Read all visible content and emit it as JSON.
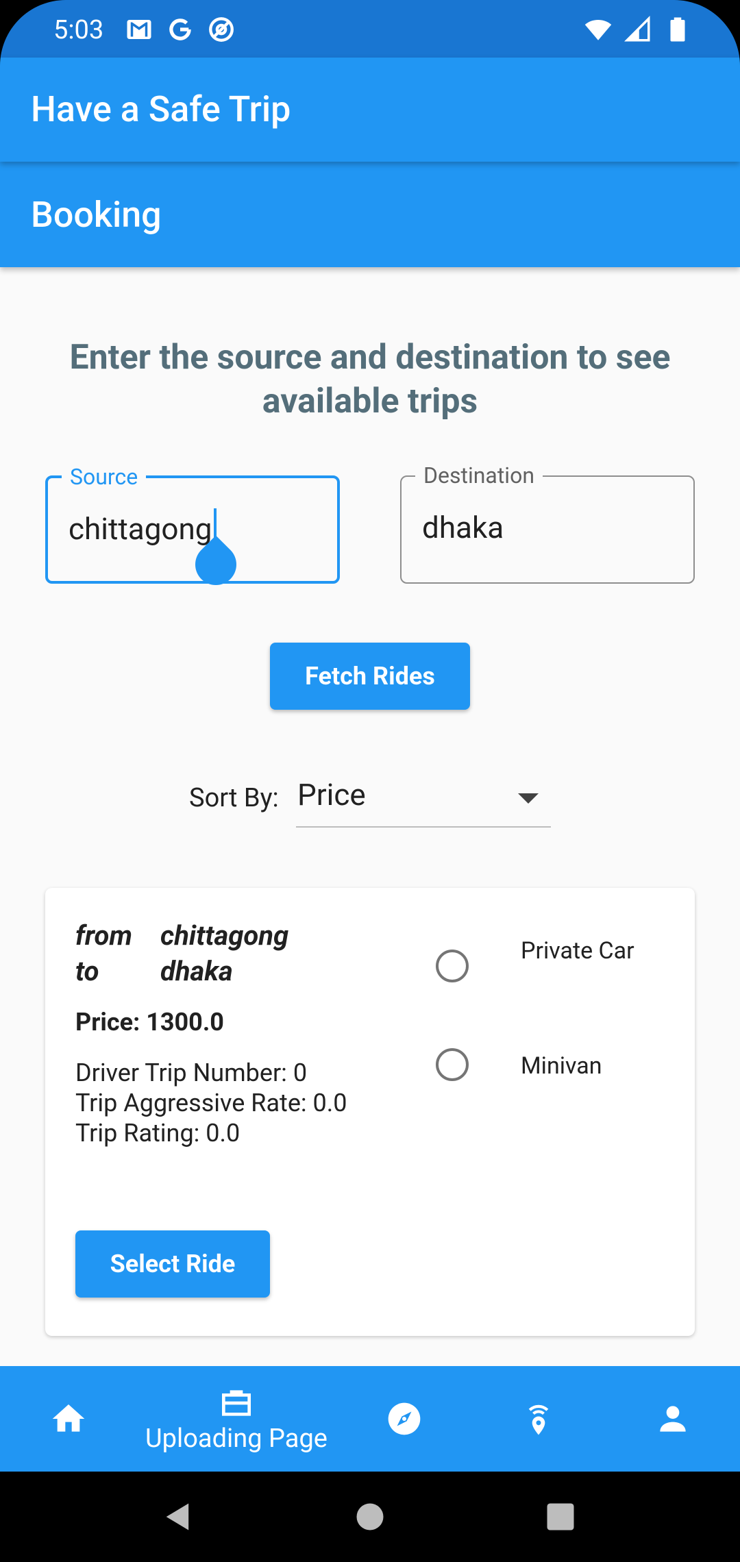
{
  "status_bar": {
    "time": "5:03",
    "left_icons": [
      "gmail-icon",
      "google-icon",
      "at-sign-icon"
    ],
    "right_icons": [
      "wifi-icon",
      "signal-icon",
      "battery-icon"
    ]
  },
  "appbar": {
    "title": "Have a Safe Trip"
  },
  "subbar": {
    "title": "Booking"
  },
  "main": {
    "heading": "Enter the source and destination to see available trips",
    "source": {
      "label": "Source",
      "value": "chittagong"
    },
    "destination": {
      "label": "Destination",
      "value": "dhaka"
    },
    "fetch_button": "Fetch Rides",
    "sort": {
      "label": "Sort By:",
      "selected": "Price"
    }
  },
  "ride_card": {
    "from_kw": "from",
    "from_value": "chittagong",
    "to_kw": "to",
    "to_value": "dhaka",
    "price": "Price: 1300.0",
    "driver_trip_number": "Driver Trip Number: 0",
    "trip_aggressive_rate": "Trip Aggressive Rate: 0.0",
    "trip_rating": "Trip Rating: 0.0",
    "select_button": "Select Ride",
    "vehicle_options": [
      {
        "label": "Private Car",
        "selected": false
      },
      {
        "label": "Minivan",
        "selected": false
      }
    ]
  },
  "bottom_nav": {
    "items": [
      {
        "icon": "home-icon",
        "label": ""
      },
      {
        "icon": "briefcase-icon",
        "label": "Uploading Page"
      },
      {
        "icon": "compass-icon",
        "label": ""
      },
      {
        "icon": "location-broadcast-icon",
        "label": ""
      },
      {
        "icon": "person-icon",
        "label": ""
      }
    ]
  },
  "colors": {
    "status_bar": "#1976D2",
    "primary": "#2196F3",
    "heading_text": "#546E7A",
    "background": "#FAFAFA"
  }
}
